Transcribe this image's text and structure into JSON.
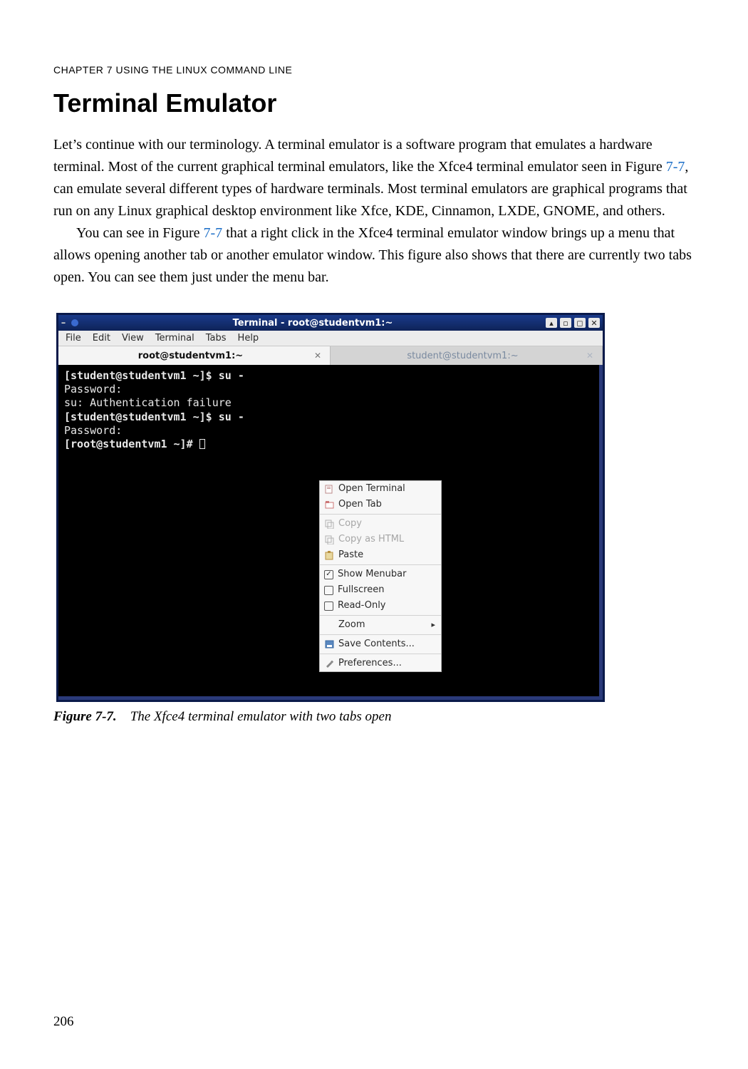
{
  "chapterHeader": "CHAPTER 7    USING THE LINUX COMMAND LINE",
  "sectionTitle": "Terminal Emulator",
  "para1a": "Let’s continue with our terminology. A terminal emulator is a software program that emulates a hardware terminal. Most of the current graphical terminal emulators, like the Xfce4 terminal emulator seen in Figure ",
  "figref1": "7-7",
  "para1b": ", can emulate several different types of hardware terminals. Most terminal emulators are graphical programs that run on any Linux graphical desktop environment like Xfce, KDE, Cinnamon, LXDE, GNOME, and others.",
  "para2a": "You can see in Figure ",
  "figref2": "7-7",
  "para2b": " that a right click in the Xfce4 terminal emulator window brings up a menu that allows opening another tab or another emulator window. This figure also shows that there are currently two tabs open. You can see them just under the menu bar.",
  "figureLabel": "Figure 7-7.",
  "figureCaption": "The Xfce4 terminal emulator with two tabs open",
  "pageNumber": "206",
  "terminal": {
    "title": "Terminal - root@studentvm1:~",
    "menubar": [
      "File",
      "Edit",
      "View",
      "Terminal",
      "Tabs",
      "Help"
    ],
    "tabs": [
      {
        "label": "root@studentvm1:~",
        "active": true
      },
      {
        "label": "student@studentvm1:~",
        "active": false
      }
    ],
    "lines": [
      {
        "text": "[student@studentvm1 ~]$ su -",
        "bold": true
      },
      {
        "text": "Password:",
        "bold": false
      },
      {
        "text": "su: Authentication failure",
        "bold": false
      },
      {
        "text": "[student@studentvm1 ~]$ su -",
        "bold": true
      },
      {
        "text": "Password:",
        "bold": false
      },
      {
        "text": "[root@studentvm1 ~]# ",
        "bold": true,
        "cursor": true
      }
    ],
    "contextMenu": [
      {
        "label": "Open Terminal",
        "icon": "doc"
      },
      {
        "label": "Open Tab",
        "icon": "tab"
      },
      {
        "sep": true
      },
      {
        "label": "Copy",
        "icon": "copy",
        "disabled": true
      },
      {
        "label": "Copy as HTML",
        "icon": "copy",
        "disabled": true
      },
      {
        "label": "Paste",
        "icon": "paste"
      },
      {
        "sep": true
      },
      {
        "label": "Show Menubar",
        "check": true,
        "checked": true
      },
      {
        "label": "Fullscreen",
        "check": true,
        "checked": false
      },
      {
        "label": "Read-Only",
        "check": true,
        "checked": false
      },
      {
        "sep": true
      },
      {
        "label": "Zoom",
        "submenu": true
      },
      {
        "sep": true
      },
      {
        "label": "Save Contents...",
        "icon": "save"
      },
      {
        "sep": true
      },
      {
        "label": "Preferences...",
        "icon": "pref"
      }
    ]
  }
}
